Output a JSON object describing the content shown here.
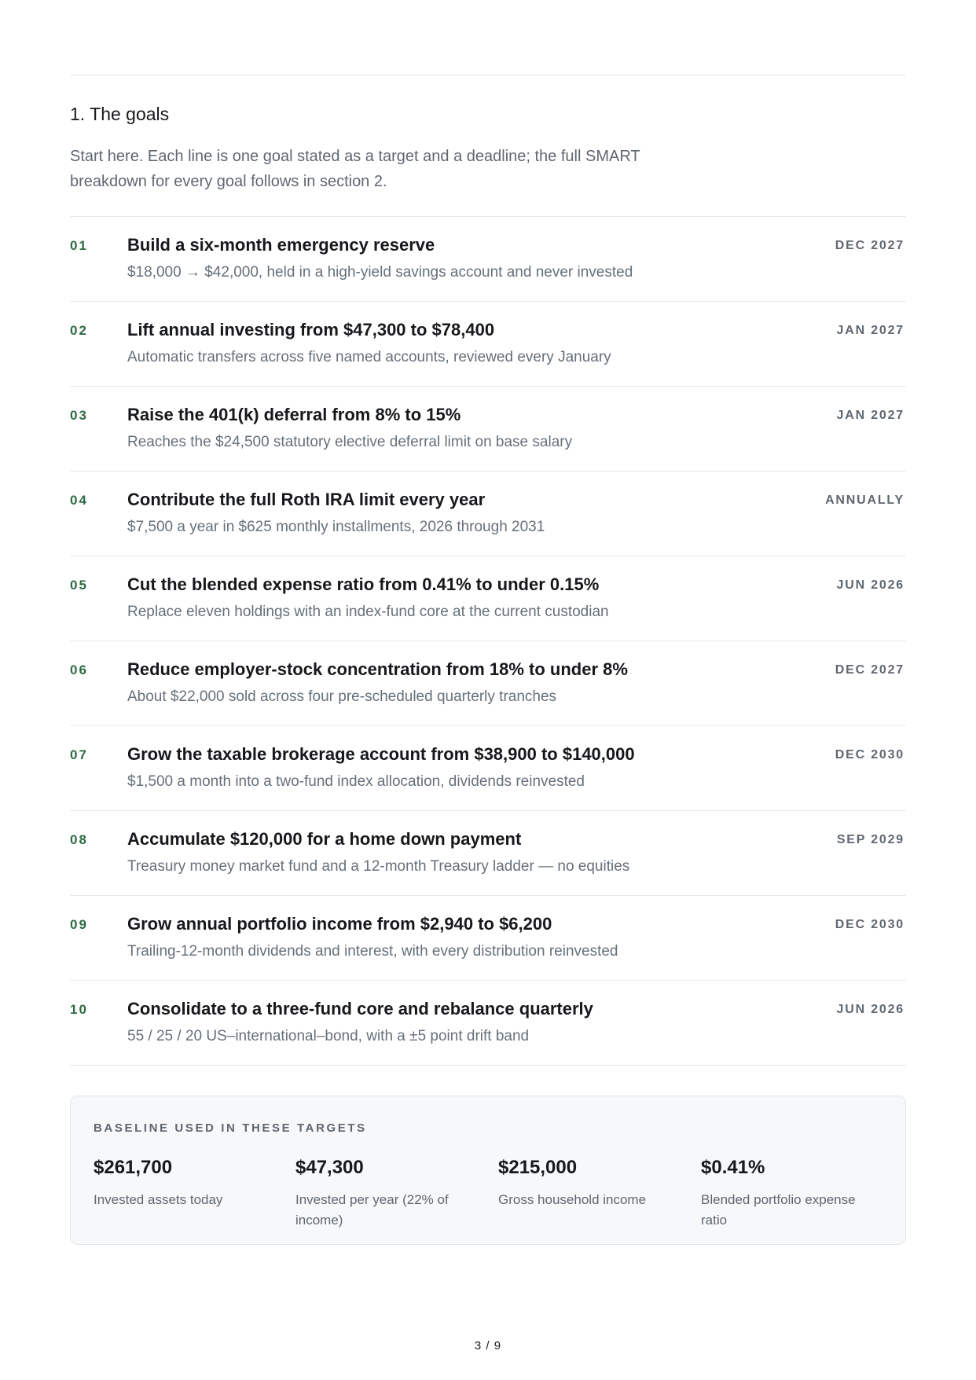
{
  "section": {
    "title": "1. The goals",
    "intro": "Start here. Each line is one goal stated as a target and a deadline; the full SMART breakdown for every goal follows in section 2."
  },
  "goals": [
    {
      "num": "01",
      "title": "Build a six-month emergency reserve",
      "desc": "$18,000 → $42,000, held in a high-yield savings account and never invested",
      "date": "DEC 2027"
    },
    {
      "num": "02",
      "title": "Lift annual investing from $47,300 to $78,400",
      "desc": "Automatic transfers across five named accounts, reviewed every January",
      "date": "JAN 2027"
    },
    {
      "num": "03",
      "title": "Raise the 401(k) deferral from 8% to 15%",
      "desc": "Reaches the $24,500 statutory elective deferral limit on base salary",
      "date": "JAN 2027"
    },
    {
      "num": "04",
      "title": "Contribute the full Roth IRA limit every year",
      "desc": "$7,500 a year in $625 monthly installments, 2026 through 2031",
      "date": "ANNUALLY"
    },
    {
      "num": "05",
      "title": "Cut the blended expense ratio from 0.41% to under 0.15%",
      "desc": "Replace eleven holdings with an index-fund core at the current custodian",
      "date": "JUN 2026"
    },
    {
      "num": "06",
      "title": "Reduce employer-stock concentration from 18% to under 8%",
      "desc": "About $22,000 sold across four pre-scheduled quarterly tranches",
      "date": "DEC 2027"
    },
    {
      "num": "07",
      "title": "Grow the taxable brokerage account from $38,900 to $140,000",
      "desc": "$1,500 a month into a two-fund index allocation, dividends reinvested",
      "date": "DEC 2030"
    },
    {
      "num": "08",
      "title": "Accumulate $120,000 for a home down payment",
      "desc": "Treasury money market fund and a 12-month Treasury ladder — no equities",
      "date": "SEP 2029"
    },
    {
      "num": "09",
      "title": "Grow annual portfolio income from $2,940 to $6,200",
      "desc": "Trailing-12-month dividends and interest, with every distribution reinvested",
      "date": "DEC 2030"
    },
    {
      "num": "10",
      "title": "Consolidate to a three-fund core and rebalance quarterly",
      "desc": "55 / 25 / 20 US–international–bond, with a ±5 point drift band",
      "date": "JUN 2026"
    }
  ],
  "baseline": {
    "label": "BASELINE USED IN THESE TARGETS",
    "stats": [
      {
        "value": "$261,700",
        "caption": "Invested assets today"
      },
      {
        "value": "$47,300",
        "caption": "Invested per year (22% of income)"
      },
      {
        "value": "$215,000",
        "caption": "Gross household income"
      },
      {
        "value": "$0.41%",
        "caption": "Blended portfolio expense ratio"
      }
    ]
  },
  "footer": {
    "page_number": "3 / 9"
  }
}
